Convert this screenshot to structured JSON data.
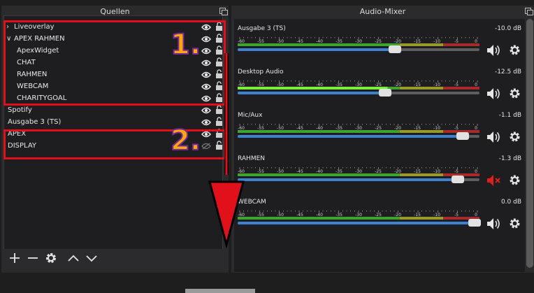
{
  "sources_panel": {
    "title": "Quellen",
    "items": [
      {
        "label": "Liveoverlay",
        "indent": 0,
        "chevron": "chevron-right-icon",
        "visible": true
      },
      {
        "label": "APEX RAHMEN",
        "indent": 0,
        "chevron": "chevron-down-icon",
        "visible": true
      },
      {
        "label": "ApexWidget",
        "indent": 1,
        "visible": true
      },
      {
        "label": "CHAT",
        "indent": 1,
        "visible": true
      },
      {
        "label": "RAHMEN",
        "indent": 1,
        "visible": true
      },
      {
        "label": "WEBCAM",
        "indent": 1,
        "visible": true
      },
      {
        "label": "CHARITYGOAL",
        "indent": 1,
        "visible": true
      },
      {
        "label": "Spotify",
        "indent": 0,
        "visible": true
      },
      {
        "label": "Ausgabe 3 (TS)",
        "indent": 0,
        "visible": true
      },
      {
        "label": "APEX",
        "indent": 0,
        "visible": true
      },
      {
        "label": "DISPLAY",
        "indent": 0,
        "visible": false
      }
    ],
    "toolbar_icons": [
      "add-icon",
      "remove-icon",
      "gear-icon",
      "move-up-icon",
      "move-down-icon"
    ]
  },
  "annotations": {
    "label_1": "1.",
    "label_2": "2.",
    "highlight_color": "#e0111b",
    "number_color": "#ffa800"
  },
  "mixer_panel": {
    "title": "Audio-Mixer",
    "tick_labels": [
      "-60",
      "-55",
      "-50",
      "-45",
      "-40",
      "-35",
      "-30",
      "-25",
      "-20",
      "-15",
      "-10",
      "-5",
      "0"
    ],
    "channels": [
      {
        "name": "Ausgabe 3 (TS)",
        "db": "-10.0 dB",
        "level": 0.0,
        "slider": 0.65,
        "muted": false
      },
      {
        "name": "Desktop Audio",
        "db": "-12.5 dB",
        "level": 0.62,
        "slider": 0.61,
        "muted": false
      },
      {
        "name": "Mic/Aux",
        "db": "-1.1 dB",
        "level": 0.0,
        "slider": 0.93,
        "muted": false
      },
      {
        "name": "RAHMEN",
        "db": "-1.3 dB",
        "level": 0.0,
        "slider": 0.91,
        "muted": true
      },
      {
        "name": "WEBCAM",
        "db": "0.0 dB",
        "level": 0.0,
        "slider": 0.98,
        "muted": false
      }
    ]
  },
  "colors": {
    "meter_green": "#3fa32f",
    "meter_green_active": "#7bf03b",
    "meter_yellow": "#9a9a2a",
    "meter_red": "#a82a2a",
    "slider_blue": "#3c82d0",
    "mute_red": "#e02020"
  }
}
